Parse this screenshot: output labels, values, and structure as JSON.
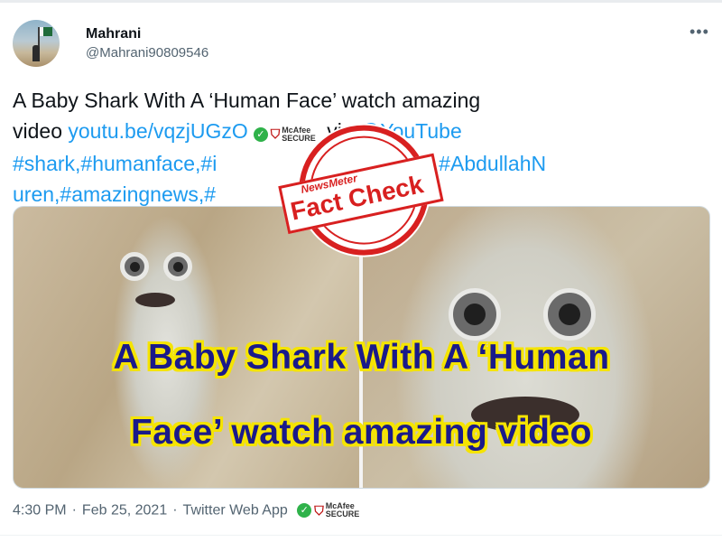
{
  "author": {
    "name": "Mahrani",
    "handle": "@Mahrani90809546",
    "avatar_icon": "avatar-flag-icon"
  },
  "more_label": "•••",
  "tweet": {
    "text_line1": "A Baby Shark With A ‘Human Face’ watch amazing",
    "text_line2_prefix": "video ",
    "link": "youtu.be/vqzjUGzO",
    "via": " via ",
    "youtube_mention": "@YouTube",
    "hashtags_line3_a": "#shark,#humanface,#i",
    "hashtags_line3_b": "sherman,#AbdullahN",
    "hashtags_line4": "uren,#amazingnews,#"
  },
  "badges": {
    "mcafee_line1": "McAfee",
    "mcafee_line2": "SECURE",
    "green_icon": "shield-check-icon"
  },
  "media": {
    "caption_line1": "A Baby Shark With A ‘Human",
    "caption_line2": "Face’ watch amazing video",
    "caption_color": "#1a1a8a",
    "caption_outline_color": "#f5e400"
  },
  "stamp": {
    "brand": "NewsMeter",
    "label": "Fact Check",
    "color": "#d82020"
  },
  "meta": {
    "time": "4:30 PM",
    "separator": "·",
    "date": "Feb 25, 2021",
    "app": "Twitter Web App"
  },
  "colors": {
    "link": "#1d9bf0",
    "text": "#0f1419",
    "muted": "#536471"
  }
}
